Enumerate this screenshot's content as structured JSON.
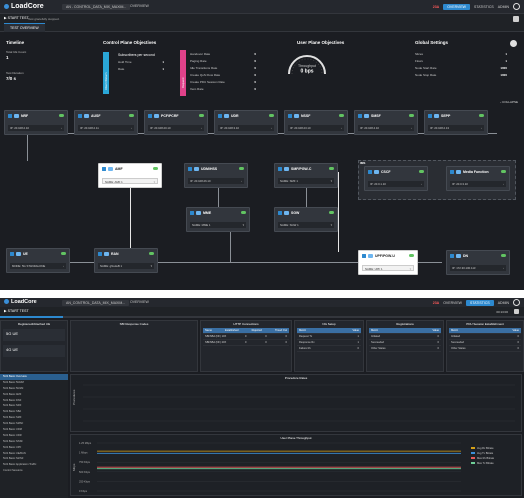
{
  "top": {
    "logo": "LoadCore",
    "breadcrumb": [
      "AN - CONTROL_DATA_MIX_MAXIM...",
      "OVERVIEW"
    ],
    "status_red": "23A",
    "tabs_right": [
      "OVERVIEW",
      "STATISTICS",
      "ADMIN"
    ],
    "start_test": "START TEST",
    "status_text": "Test gracefully stopped.",
    "active_tab": "TEST OVERVIEW",
    "timeline": {
      "title": "Timeline",
      "total_ue_label": "Total UE Count",
      "total_ue_value": "1",
      "duration_label": "Test Duration",
      "duration_value": "7/0 s"
    },
    "control_plane": {
      "title": "Control Plane Objectives",
      "left_bar": "Attach/Detach",
      "subs_label": "Subscribers per second",
      "rows": [
        {
          "label": "Hold Time",
          "value": "1"
        },
        {
          "label": "Rate",
          "value": "1"
        }
      ],
      "right_bar": "Request",
      "right_rows": [
        {
          "label": "Handover Rate",
          "value": "0"
        },
        {
          "label": "Paging Rate",
          "value": "0"
        },
        {
          "label": "Idle Transitions Rate",
          "value": "0"
        },
        {
          "label": "Create QoS Flow Rate",
          "value": "0"
        },
        {
          "label": "Create PDU Session Rate",
          "value": "0"
        },
        {
          "label": "Xero Rate",
          "value": "0"
        }
      ]
    },
    "user_plane": {
      "title": "User Plane Objectives",
      "gauge_label": "Throughput",
      "gauge_value": "0 bps"
    },
    "global": {
      "title": "Global Settings",
      "rows": [
        {
          "label": "Slices",
          "value": "1"
        },
        {
          "label": "Flows",
          "value": "1"
        },
        {
          "label": "Node Start Rate",
          "value": "1000"
        },
        {
          "label": "Node Stop Rate",
          "value": "1000"
        }
      ]
    },
    "collapse": "COLLAPSE",
    "nodes_row1": [
      {
        "name": "NRF",
        "ip": "IP: 20.108.2.10"
      },
      {
        "name": "AUSF",
        "ip": "IP: 20.108.2.11"
      },
      {
        "name": "PCF/PCRF",
        "ip": "IP: 20.108.20.10"
      },
      {
        "name": "UDR",
        "ip": "IP: 20.108.3.10"
      },
      {
        "name": "NSSF",
        "ip": "IP: 20.108.23.10"
      },
      {
        "name": "SMSF",
        "ip": "IP: 20.108.4.10"
      },
      {
        "name": "SEPP",
        "ip": "IP: 20.108.2.13"
      }
    ],
    "nodes_row2": [
      {
        "name": "AMF",
        "ip": "NAME: AMF 1"
      },
      {
        "name": "UDM/HSS",
        "ip": "IP: 20.108.26.10"
      },
      {
        "name": "SMF/PGW-C",
        "ip": "NAME: SMF 1"
      },
      {
        "name": "CSCF",
        "ip": "IP: 20.0.1.10"
      },
      {
        "name": "Media Function",
        "ip": "IP: 20.0.3.10"
      }
    ],
    "ims_label": "IMS",
    "nodes_row3": [
      {
        "name": "MME",
        "ip": "NAME: MME 1"
      },
      {
        "name": "SGW",
        "ip": "NAME: SGW 1"
      }
    ],
    "nodes_row4": [
      {
        "name": "UE",
        "ip": "MODE: 5G STANDALONE"
      },
      {
        "name": "RAN",
        "ip": "NAME: gNodeB 1"
      },
      {
        "name": "UPF/PGW-U",
        "ip": "NAME: UPF 1"
      },
      {
        "name": "DN",
        "ip": "IP: 172.30.100.113"
      }
    ]
  },
  "bottom": {
    "logo": "LoadCore",
    "breadcrumb": [
      "AN_CONTROL_DATA_MIX_MAXIM...",
      "OVERVIEW"
    ],
    "status_red": "23A",
    "tabs_right": [
      "OVERVIEW",
      "STATISTICS",
      "ADMIN"
    ],
    "start_test": "START TEST",
    "runtime": "00:13:00",
    "progress": 0.12,
    "registered_title": "Registered/Attached UE",
    "ue_boxes": [
      "5G UE",
      "4G UE"
    ],
    "stat_titles": [
      "SBI Response Codes",
      "HTTP Connections",
      "NG Setup",
      "Registrations",
      "PDU Session Establishment"
    ],
    "http_headers": [
      "Name",
      "Established",
      "Rejected",
      "Timed Out"
    ],
    "http_rows": [
      [
        "SBI/SBA (NF) 10X",
        "0",
        "0",
        "0"
      ],
      [
        "SBI/SBA (NF) 20X",
        "0",
        "0",
        "0"
      ]
    ],
    "ng_headers": [
      "Metric",
      "Value"
    ],
    "ng_rows": [
      [
        "Request Tx",
        "1"
      ],
      [
        "Response Rx",
        "1"
      ],
      [
        "Failure Rx",
        "0"
      ]
    ],
    "reg_headers": [
      "Metric",
      "Value"
    ],
    "reg_rows": [
      [
        "Initiated",
        "0"
      ],
      [
        "Succeeded",
        "0"
      ],
      [
        "Other States",
        "0"
      ]
    ],
    "pdu_headers": [
      "Metric",
      "Value"
    ],
    "pdu_rows": [
      [
        "Initiated",
        "0"
      ],
      [
        "Succeeded",
        "0"
      ],
      [
        "Other States",
        "0"
      ]
    ],
    "side_items": [
      "5GS Basic Overview",
      "5GS Basic 5GMM",
      "5GS Basic 5GSM",
      "5GS Basic AMF",
      "5GS Basic DNF",
      "5GS Basic NRF",
      "5GS Basic SBA",
      "5GS Basic SMF",
      "5GS Basic SMSF",
      "5GS Basic UDM",
      "5GS Basic UDR",
      "5GS Basic NSSF",
      "5GS Basic UPF",
      "5GS Basic UE/RAN",
      "5GS Basic N2/N3",
      "5GS Basic Application Traffic",
      "Control Sessions"
    ],
    "chart1_title": "Procedure Rates",
    "chart1_ylabel": "Procedures",
    "chart2_title": "User Plane Throughput",
    "chart2_ylabel": "Mbps",
    "chart2_ticks": [
      "1.25 Mbps",
      "1 Mbps",
      "750 Kbps",
      "500 Kbps",
      "250 Kbps",
      "0 Kbps"
    ],
    "chart2_legend": [
      "Avg Rx Bitrate",
      "Avg Tx Bitrate",
      "Max Rx Bitrate",
      "Max Tx Bitrate"
    ]
  },
  "chart_data": {
    "type": "line",
    "title": "User Plane Throughput",
    "ylabel": "Mbps",
    "series": [
      {
        "name": "Avg Rx Bitrate",
        "color": "#d4a017",
        "values": [
          1.04,
          1.04,
          1.04,
          1.04,
          1.04,
          1.04,
          1.04,
          1.04,
          1.04,
          1.04
        ]
      },
      {
        "name": "Avg Tx Bitrate",
        "color": "#3a8fd8",
        "values": [
          0.98,
          0.98,
          0.98,
          0.98,
          0.98,
          0.98,
          0.98,
          0.98,
          0.98,
          0.98
        ]
      },
      {
        "name": "Max Rx Bitrate",
        "color": "#e65a5a",
        "values": [
          0.62,
          0.62,
          0.62,
          0.62,
          0.62,
          0.62,
          0.62,
          0.62,
          0.62,
          0.62
        ]
      },
      {
        "name": "Max Tx Bitrate",
        "color": "#6fcf97",
        "values": [
          0.58,
          0.58,
          0.58,
          0.58,
          0.58,
          0.58,
          0.58,
          0.58,
          0.58,
          0.58
        ]
      }
    ],
    "ylim": [
      0,
      1.25
    ]
  },
  "colors": {
    "accent": "#2d89cf",
    "cyan_bar": "#2aa7d8",
    "pink_bar": "#e0428a",
    "ok": "#62c462"
  }
}
